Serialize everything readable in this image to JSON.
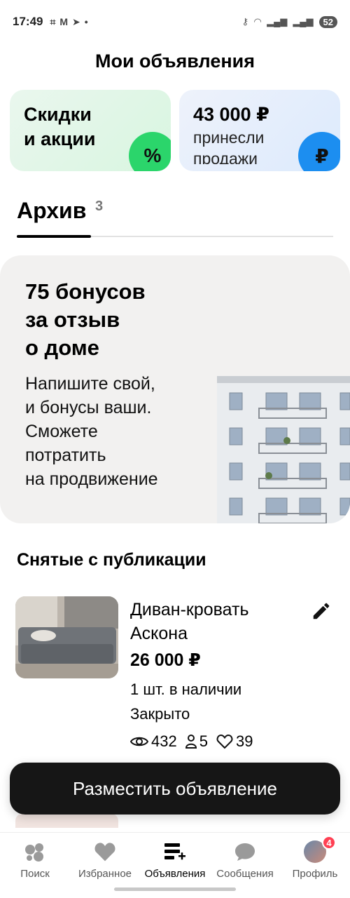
{
  "status_bar": {
    "time": "17:49",
    "battery": "52"
  },
  "header": {
    "title": "Мои объявления"
  },
  "promo_cards": {
    "discounts": {
      "line1": "Скидки",
      "line2": "и акции",
      "badge": "%"
    },
    "sales": {
      "amount": "43 000 ₽",
      "line1": "принесли",
      "line2": "продажи",
      "badge": "₽"
    }
  },
  "tabs": {
    "active_label": "Архив",
    "active_count": "3"
  },
  "bonus_banner": {
    "title_line1": "75 бонусов",
    "title_line2": "за отзыв",
    "title_line3": "о доме",
    "text_line1": "Напишите свой,",
    "text_line2": "и бонусы ваши.",
    "text_line3": "Сможете",
    "text_line4": "потратить",
    "text_line5": "на продвижение"
  },
  "section": {
    "title": "Снятые с публикации"
  },
  "listing": {
    "title_line1": "Диван-кровать",
    "title_line2": "Аскона",
    "price": "26 000 ₽",
    "stock": "1 шт. в наличии",
    "status": "Закрыто",
    "views": "432",
    "contacts": "5",
    "favorites": "39"
  },
  "post_button": {
    "label": "Разместить объявление"
  },
  "bottom_nav": {
    "items": [
      {
        "label": "Поиск",
        "icon": "search-dots-icon"
      },
      {
        "label": "Избранное",
        "icon": "heart-icon"
      },
      {
        "label": "Объявления",
        "icon": "listings-add-icon"
      },
      {
        "label": "Сообщения",
        "icon": "chat-bubble-icon"
      },
      {
        "label": "Профиль",
        "icon": "avatar"
      }
    ],
    "profile_badge": "4",
    "active_index": 2
  },
  "colors": {
    "accent_green": "#2bd56b",
    "accent_blue": "#1c8ef0",
    "badge_red": "#ff4053",
    "dark_button": "#161616"
  }
}
